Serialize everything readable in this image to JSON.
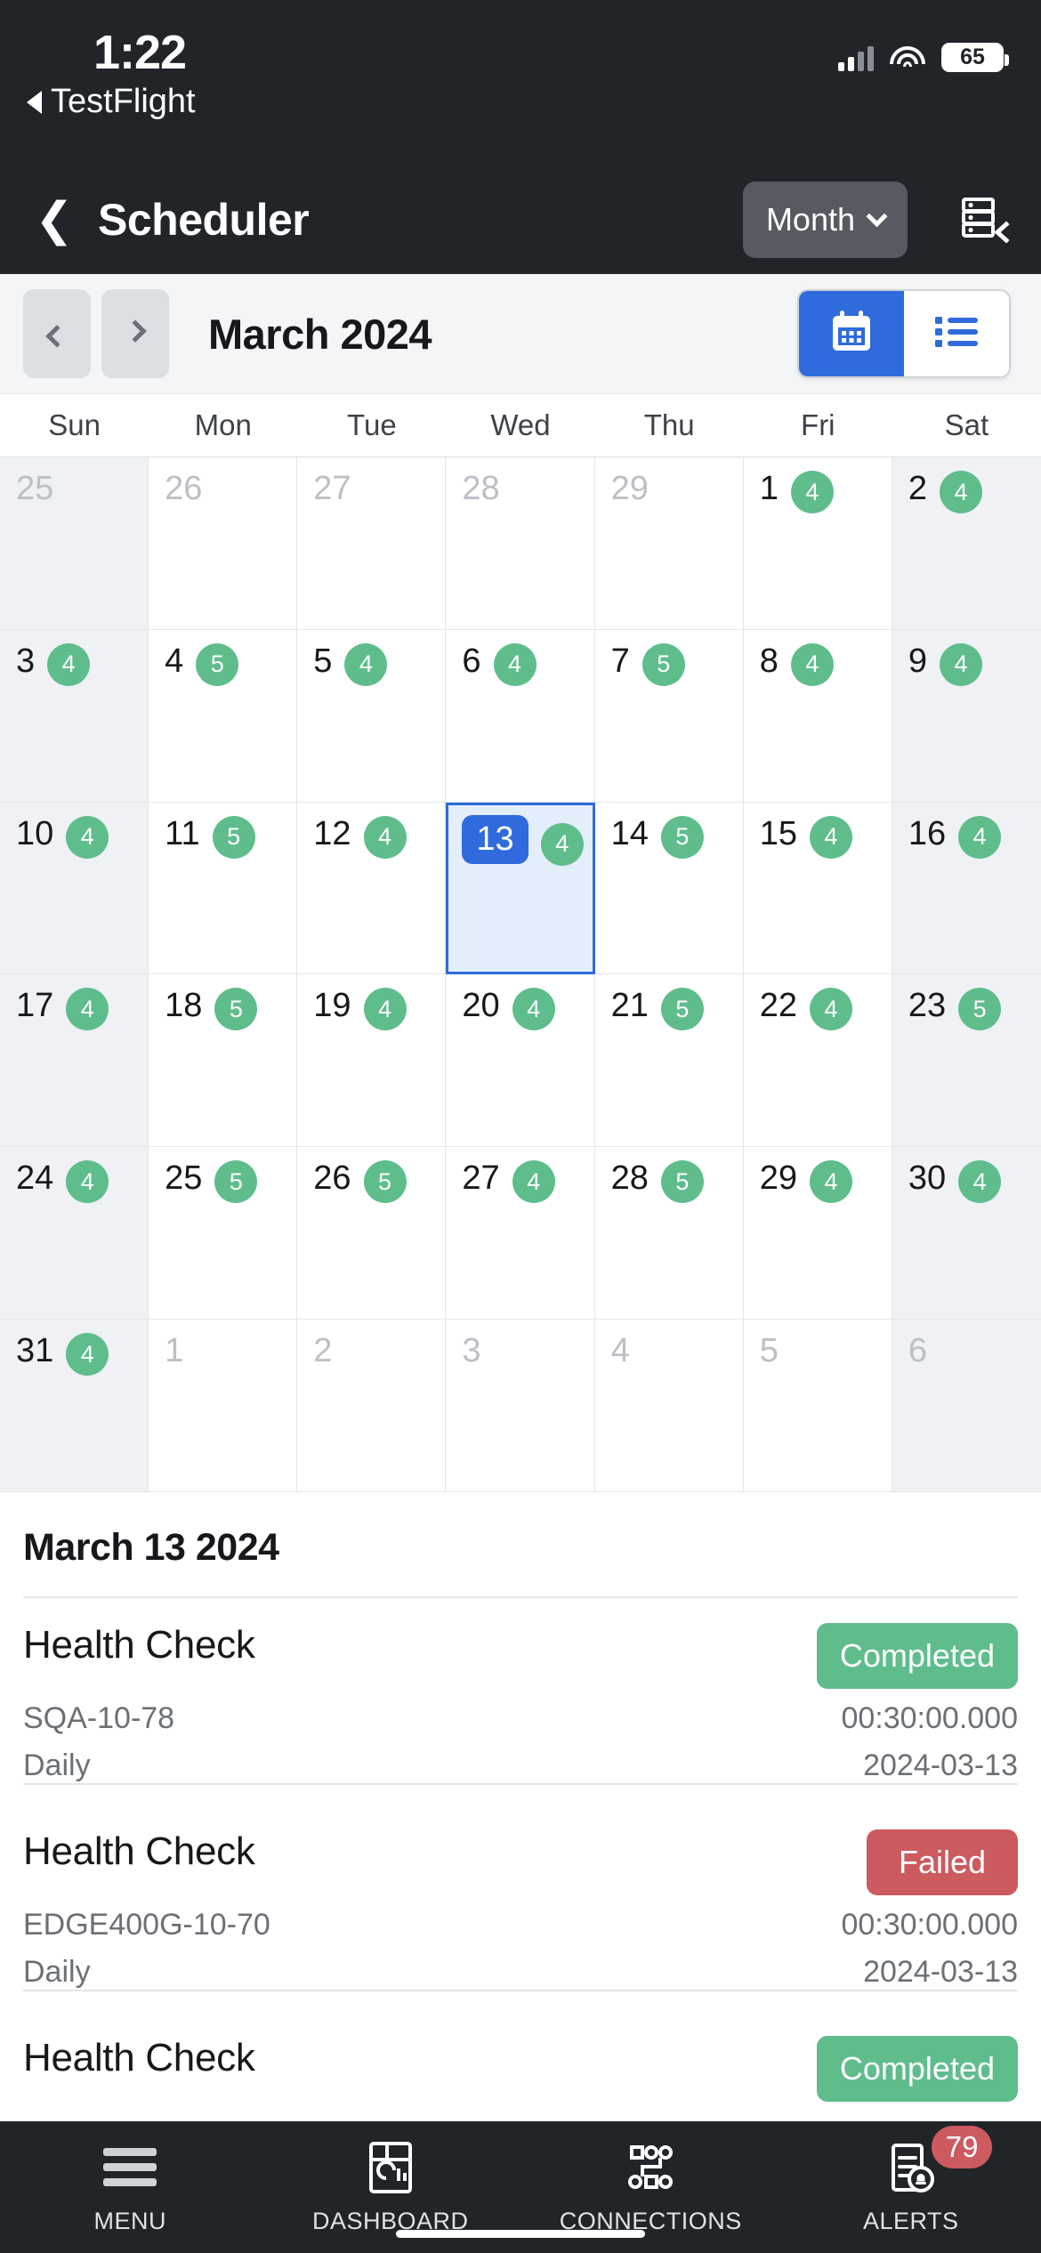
{
  "status_bar": {
    "time": "1:22",
    "back_app": "TestFlight",
    "battery_level": "65",
    "signal_icon": "cellular-bars-icon",
    "wifi_icon": "wifi-icon",
    "battery_icon": "battery-icon"
  },
  "navbar": {
    "back_icon": "chevron-left-icon",
    "title": "Scheduler",
    "view_selector_label": "Month",
    "view_selector_icon": "chevron-down-icon",
    "server_icon": "server-select-icon"
  },
  "calendar_toolbar": {
    "prev_icon": "chevron-left-icon",
    "next_icon": "chevron-right-icon",
    "month_title": "March 2024",
    "segments": [
      {
        "name": "calendar-view",
        "icon": "calendar-icon",
        "active": true
      },
      {
        "name": "list-view",
        "icon": "list-icon",
        "active": false
      }
    ]
  },
  "calendar": {
    "weekdays": [
      "Sun",
      "Mon",
      "Tue",
      "Wed",
      "Thu",
      "Fri",
      "Sat"
    ],
    "accent_color": "#2f6bdc",
    "count_badge_color": "#5fbd8c",
    "selected_day": 13,
    "days": [
      {
        "label": "25",
        "other": true,
        "count": null,
        "weekend": true
      },
      {
        "label": "26",
        "other": true,
        "count": null,
        "weekend": false
      },
      {
        "label": "27",
        "other": true,
        "count": null,
        "weekend": false
      },
      {
        "label": "28",
        "other": true,
        "count": null,
        "weekend": false
      },
      {
        "label": "29",
        "other": true,
        "count": null,
        "weekend": false
      },
      {
        "label": "1",
        "other": false,
        "count": "4",
        "weekend": false
      },
      {
        "label": "2",
        "other": false,
        "count": "4",
        "weekend": true
      },
      {
        "label": "3",
        "other": false,
        "count": "4",
        "weekend": true
      },
      {
        "label": "4",
        "other": false,
        "count": "5",
        "weekend": false
      },
      {
        "label": "5",
        "other": false,
        "count": "4",
        "weekend": false
      },
      {
        "label": "6",
        "other": false,
        "count": "4",
        "weekend": false
      },
      {
        "label": "7",
        "other": false,
        "count": "5",
        "weekend": false
      },
      {
        "label": "8",
        "other": false,
        "count": "4",
        "weekend": false
      },
      {
        "label": "9",
        "other": false,
        "count": "4",
        "weekend": true
      },
      {
        "label": "10",
        "other": false,
        "count": "4",
        "weekend": true
      },
      {
        "label": "11",
        "other": false,
        "count": "5",
        "weekend": false
      },
      {
        "label": "12",
        "other": false,
        "count": "4",
        "weekend": false
      },
      {
        "label": "13",
        "other": false,
        "count": "4",
        "weekend": false,
        "selected": true
      },
      {
        "label": "14",
        "other": false,
        "count": "5",
        "weekend": false
      },
      {
        "label": "15",
        "other": false,
        "count": "4",
        "weekend": false
      },
      {
        "label": "16",
        "other": false,
        "count": "4",
        "weekend": true
      },
      {
        "label": "17",
        "other": false,
        "count": "4",
        "weekend": true
      },
      {
        "label": "18",
        "other": false,
        "count": "5",
        "weekend": false
      },
      {
        "label": "19",
        "other": false,
        "count": "4",
        "weekend": false
      },
      {
        "label": "20",
        "other": false,
        "count": "4",
        "weekend": false
      },
      {
        "label": "21",
        "other": false,
        "count": "5",
        "weekend": false
      },
      {
        "label": "22",
        "other": false,
        "count": "4",
        "weekend": false
      },
      {
        "label": "23",
        "other": false,
        "count": "5",
        "weekend": true
      },
      {
        "label": "24",
        "other": false,
        "count": "4",
        "weekend": true
      },
      {
        "label": "25",
        "other": false,
        "count": "5",
        "weekend": false
      },
      {
        "label": "26",
        "other": false,
        "count": "5",
        "weekend": false
      },
      {
        "label": "27",
        "other": false,
        "count": "4",
        "weekend": false
      },
      {
        "label": "28",
        "other": false,
        "count": "5",
        "weekend": false
      },
      {
        "label": "29",
        "other": false,
        "count": "4",
        "weekend": false
      },
      {
        "label": "30",
        "other": false,
        "count": "4",
        "weekend": true
      },
      {
        "label": "31",
        "other": false,
        "count": "4",
        "weekend": true
      },
      {
        "label": "1",
        "other": true,
        "count": null,
        "weekend": false
      },
      {
        "label": "2",
        "other": true,
        "count": null,
        "weekend": false
      },
      {
        "label": "3",
        "other": true,
        "count": null,
        "weekend": false
      },
      {
        "label": "4",
        "other": true,
        "count": null,
        "weekend": false
      },
      {
        "label": "5",
        "other": true,
        "count": null,
        "weekend": false
      },
      {
        "label": "6",
        "other": true,
        "count": null,
        "weekend": true
      }
    ]
  },
  "day_detail": {
    "title": "March 13 2024",
    "events": [
      {
        "name": "Health Check",
        "status": "Completed",
        "status_type": "completed",
        "device": "SQA-10-78",
        "duration": "00:30:00.000",
        "frequency": "Daily",
        "date": "2024-03-13"
      },
      {
        "name": "Health Check",
        "status": "Failed",
        "status_type": "failed",
        "device": "EDGE400G-10-70",
        "duration": "00:30:00.000",
        "frequency": "Daily",
        "date": "2024-03-13"
      },
      {
        "name": "Health Check",
        "status": "Completed",
        "status_type": "completed"
      }
    ]
  },
  "tabbar": {
    "items": [
      {
        "label": "MENU",
        "icon": "hamburger-menu-icon",
        "badge": null
      },
      {
        "label": "DASHBOARD",
        "icon": "dashboard-icon",
        "badge": null
      },
      {
        "label": "CONNECTIONS",
        "icon": "connections-icon",
        "badge": null
      },
      {
        "label": "ALERTS",
        "icon": "alerts-bell-icon",
        "badge": "79"
      }
    ]
  }
}
